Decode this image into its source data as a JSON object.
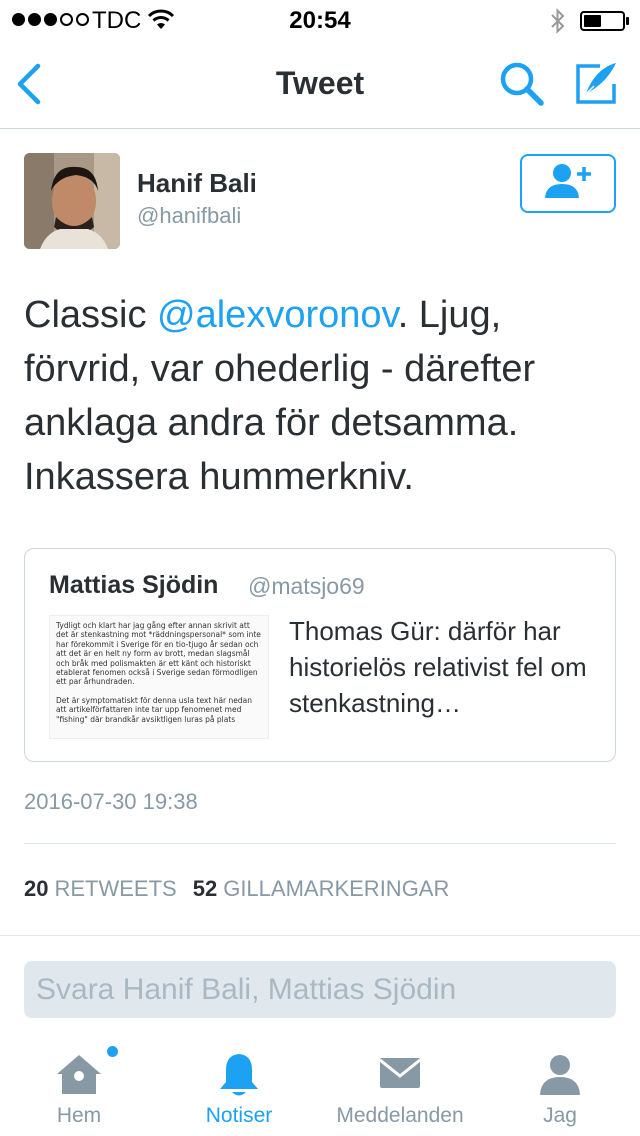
{
  "status_bar": {
    "carrier": "TDC",
    "time": "20:54",
    "signal_bars_filled": 3,
    "signal_bars_total": 5
  },
  "nav": {
    "title": "Tweet",
    "back_icon": "chevron-left-icon",
    "search_icon": "search-icon",
    "compose_icon": "compose-icon"
  },
  "tweet": {
    "author_name": "Hanif Bali",
    "author_handle": "@hanifbali",
    "text_before": "Classic ",
    "mention": "@alexvoronov",
    "text_after": ". Ljug, förvrid, var ohederlig - därefter anklaga andra för detsamma. Inkassera hummerkniv.",
    "timestamp": "2016-07-30 19:38",
    "retweets_count": "20",
    "retweets_label": "RETWEETS",
    "likes_count": "52",
    "likes_label": "GILLAMARKERINGAR"
  },
  "quoted_tweet": {
    "author_name": "Mattias Sjödin",
    "author_handle": "@matsjo69",
    "text": "Thomas Gür: därför har historielös relativist fel om stenkastning…",
    "image_text_p1": "Tydligt och klart har jag gång efter annan skrivit att det är stenkastning mot *räddningspersonal* som inte har förekommit i Sverige för en tio-tjugo år sedan och att det är en helt ny form av brott, medan slagsmål och bråk med polismakten är ett känt och historiskt etablerat fenomen också i Sverige sedan förmodligen ett par århundraden.",
    "image_text_p2": "Det är symptomatiskt för denna usla text här nedan att artikelförfattaren inte tar upp fenomenet med \"fishing\" där brandkår avsiktligen luras på plats"
  },
  "reply": {
    "placeholder": "Svara Hanif Bali, Mattias Sjödin"
  },
  "tabs": [
    {
      "label": "Hem",
      "icon": "home-icon",
      "active": false,
      "has_notification_dot": true
    },
    {
      "label": "Notiser",
      "icon": "bell-icon",
      "active": true
    },
    {
      "label": "Meddelanden",
      "icon": "envelope-icon",
      "active": false
    },
    {
      "label": "Jag",
      "icon": "person-icon",
      "active": false
    }
  ],
  "colors": {
    "accent": "#1da1f2",
    "text": "#292f33",
    "muted": "#8899a6",
    "border": "#ccd6dd",
    "tab_inactive": "#8899a6"
  }
}
